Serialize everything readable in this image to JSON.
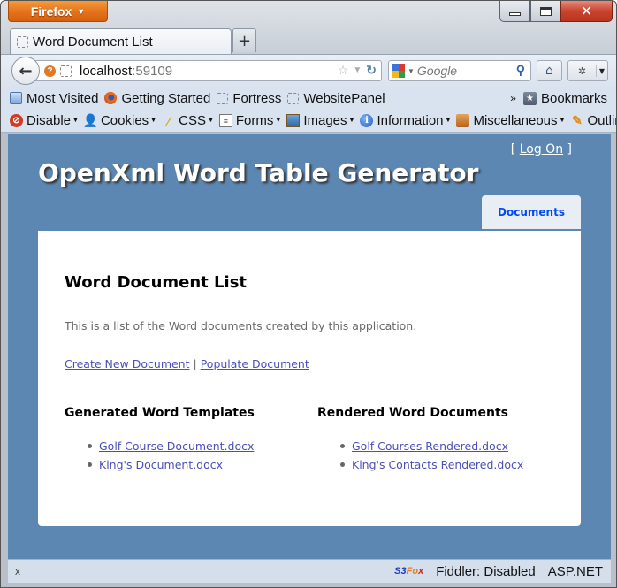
{
  "browser": {
    "app_button": "Firefox",
    "tab_title": "Word Document List",
    "new_tab": "+",
    "url_host": "localhost",
    "url_port": ":59109",
    "search_placeholder": "Google",
    "bookmarks": [
      {
        "label": "Most Visited",
        "icon": "most-visited-icon"
      },
      {
        "label": "Getting Started",
        "icon": "firefox-icon"
      },
      {
        "label": "Fortress",
        "icon": "page-icon"
      },
      {
        "label": "WebsitePanel",
        "icon": "page-icon"
      }
    ],
    "bookmarks_overflow": "»",
    "bookmarks_menu": "Bookmarks",
    "devtools": [
      {
        "label": "Disable",
        "icon": "disable-icon"
      },
      {
        "label": "Cookies",
        "icon": "cookies-icon"
      },
      {
        "label": "CSS",
        "icon": "css-icon"
      },
      {
        "label": "Forms",
        "icon": "forms-icon"
      },
      {
        "label": "Images",
        "icon": "images-icon"
      },
      {
        "label": "Information",
        "icon": "information-icon"
      },
      {
        "label": "Miscellaneous",
        "icon": "miscellaneous-icon"
      },
      {
        "label": "Outline",
        "icon": "outline-icon"
      }
    ],
    "status": {
      "close": "x",
      "s3fox_s3": "S3",
      "s3fox_fo": "Fo",
      "s3fox_x": "x",
      "fiddler": "Fiddler: Disabled",
      "aspnet": "ASP.NET"
    }
  },
  "page": {
    "login_open": "[",
    "login_link": "Log On",
    "login_close": "]",
    "site_title": "OpenXml Word Table Generator",
    "menu_tab": "Documents",
    "heading": "Word Document List",
    "intro": "This is a list of the Word documents created by this application.",
    "create_link": "Create New Document",
    "separator": "|",
    "populate_link": "Populate Document",
    "templates": {
      "heading": "Generated Word Templates",
      "items": [
        "Golf Course Document.docx",
        "King's Document.docx"
      ]
    },
    "rendered": {
      "heading": "Rendered Word Documents",
      "items": [
        "Golf Courses Rendered.docx",
        "King's Contacts Rendered.docx"
      ]
    }
  },
  "colors": {
    "page_background": "#5c87b2",
    "link": "#4a50b8",
    "menu_tab_text": "#034af3"
  }
}
